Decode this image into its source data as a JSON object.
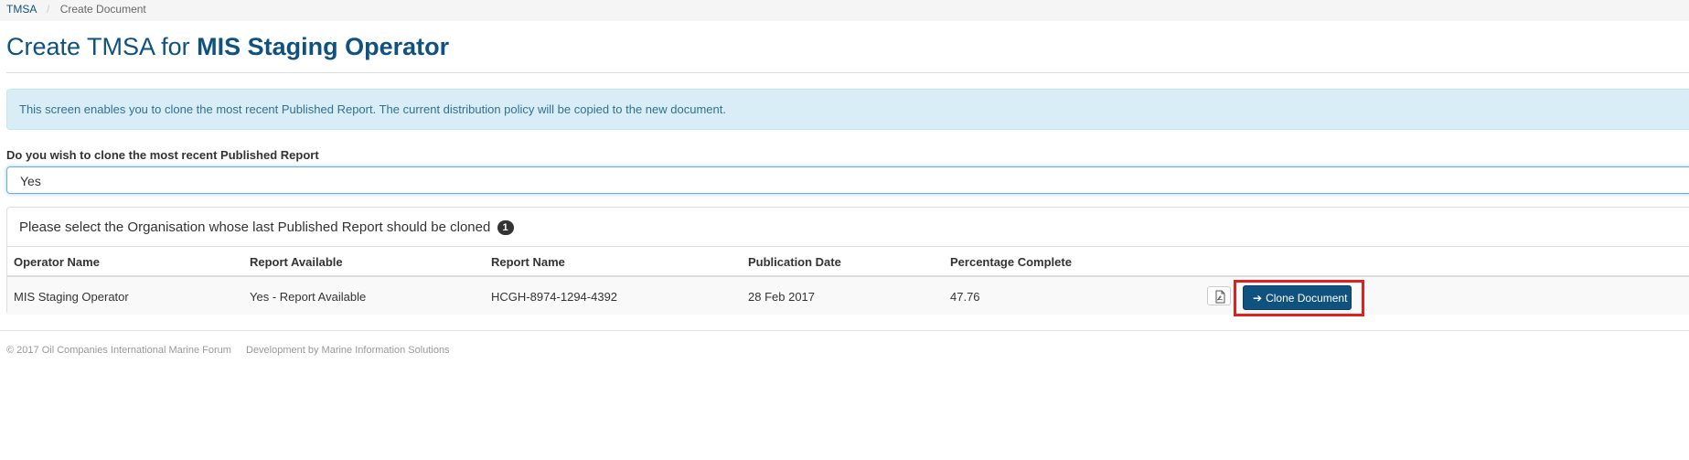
{
  "breadcrumb": {
    "home": "TMSA",
    "current": "Create Document"
  },
  "page_title": {
    "prefix": "Create TMSA for",
    "operator": "MIS Staging Operator"
  },
  "info_alert": "This screen enables you to clone the most recent Published Report. The current distribution policy will be copied to the new document.",
  "clone_question": {
    "label": "Do you wish to clone the most recent Published Report",
    "selected_value": "Yes"
  },
  "org_panel": {
    "heading": "Please select the Organisation whose last Published Report should be cloned",
    "badge_count": "1",
    "columns": [
      "Operator Name",
      "Report Available",
      "Report Name",
      "Publication Date",
      "Percentage Complete"
    ],
    "rows": [
      {
        "operator_name": "MIS Staging Operator",
        "report_available": "Yes - Report Available",
        "report_name": "HCGH-8974-1294-4392",
        "publication_date": "28 Feb 2017",
        "percentage_complete": "47.76",
        "clone_label": "Clone Document"
      }
    ]
  },
  "icons": {
    "pdf": "file-pdf-icon",
    "clone_arrow": "arrow-right-icon"
  },
  "colors": {
    "brand": "#10527f",
    "info_bg": "#d9edf7",
    "info_text": "#31708f",
    "highlight": "#e0201e"
  },
  "footer": {
    "copyright": "© 2017 Oil Companies International Marine Forum",
    "developer": "Development by Marine Information Solutions"
  }
}
